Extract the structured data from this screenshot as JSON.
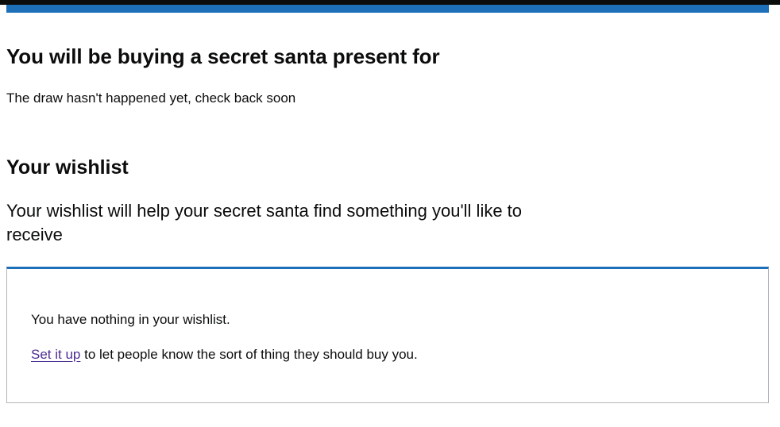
{
  "page": {
    "heading": "You will be buying a secret santa present for",
    "draw_status": "The draw hasn't happened yet, check back soon"
  },
  "wishlist": {
    "heading": "Your wishlist",
    "lead": "Your wishlist will help your secret santa find something you'll like to receive",
    "empty_message": "You have nothing in your wishlist.",
    "setup_link": "Set it up",
    "setup_suffix": " to let people know the sort of thing they should buy you."
  },
  "colors": {
    "header_bar": "#0b0c0c",
    "accent_blue": "#1d70b8",
    "link_visited": "#4c2c92",
    "panel_border": "#b1b4b6"
  }
}
